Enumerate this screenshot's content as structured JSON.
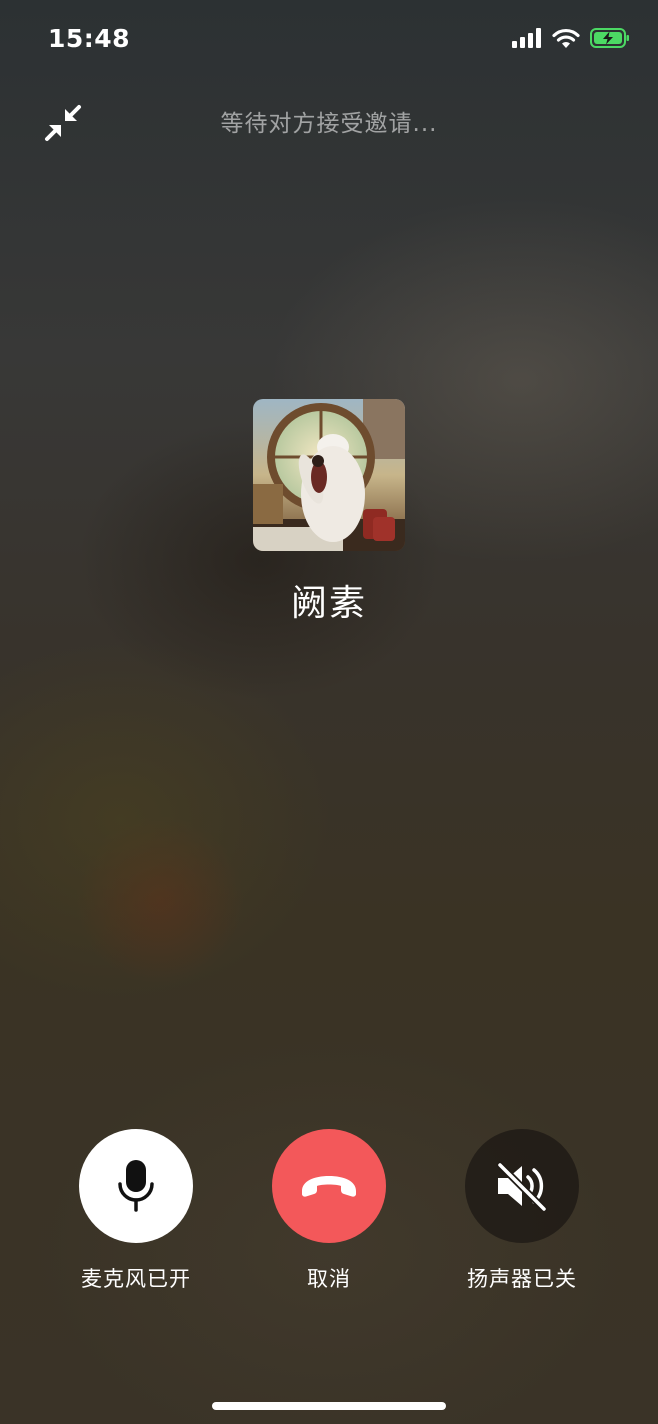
{
  "status_bar": {
    "time": "15:48"
  },
  "call": {
    "status_text": "等待对方接受邀请...",
    "contact_name": "阙素"
  },
  "controls": {
    "microphone_label": "麦克风已开",
    "cancel_label": "取消",
    "speaker_label": "扬声器已关"
  },
  "colors": {
    "cancel_red": "#f3585a",
    "battery_green": "#4cd964"
  },
  "icons": {
    "minimize": "minimize-arrows-icon",
    "microphone": "microphone-icon",
    "hang_up": "phone-hangup-icon",
    "speaker_muted": "speaker-muted-icon"
  }
}
